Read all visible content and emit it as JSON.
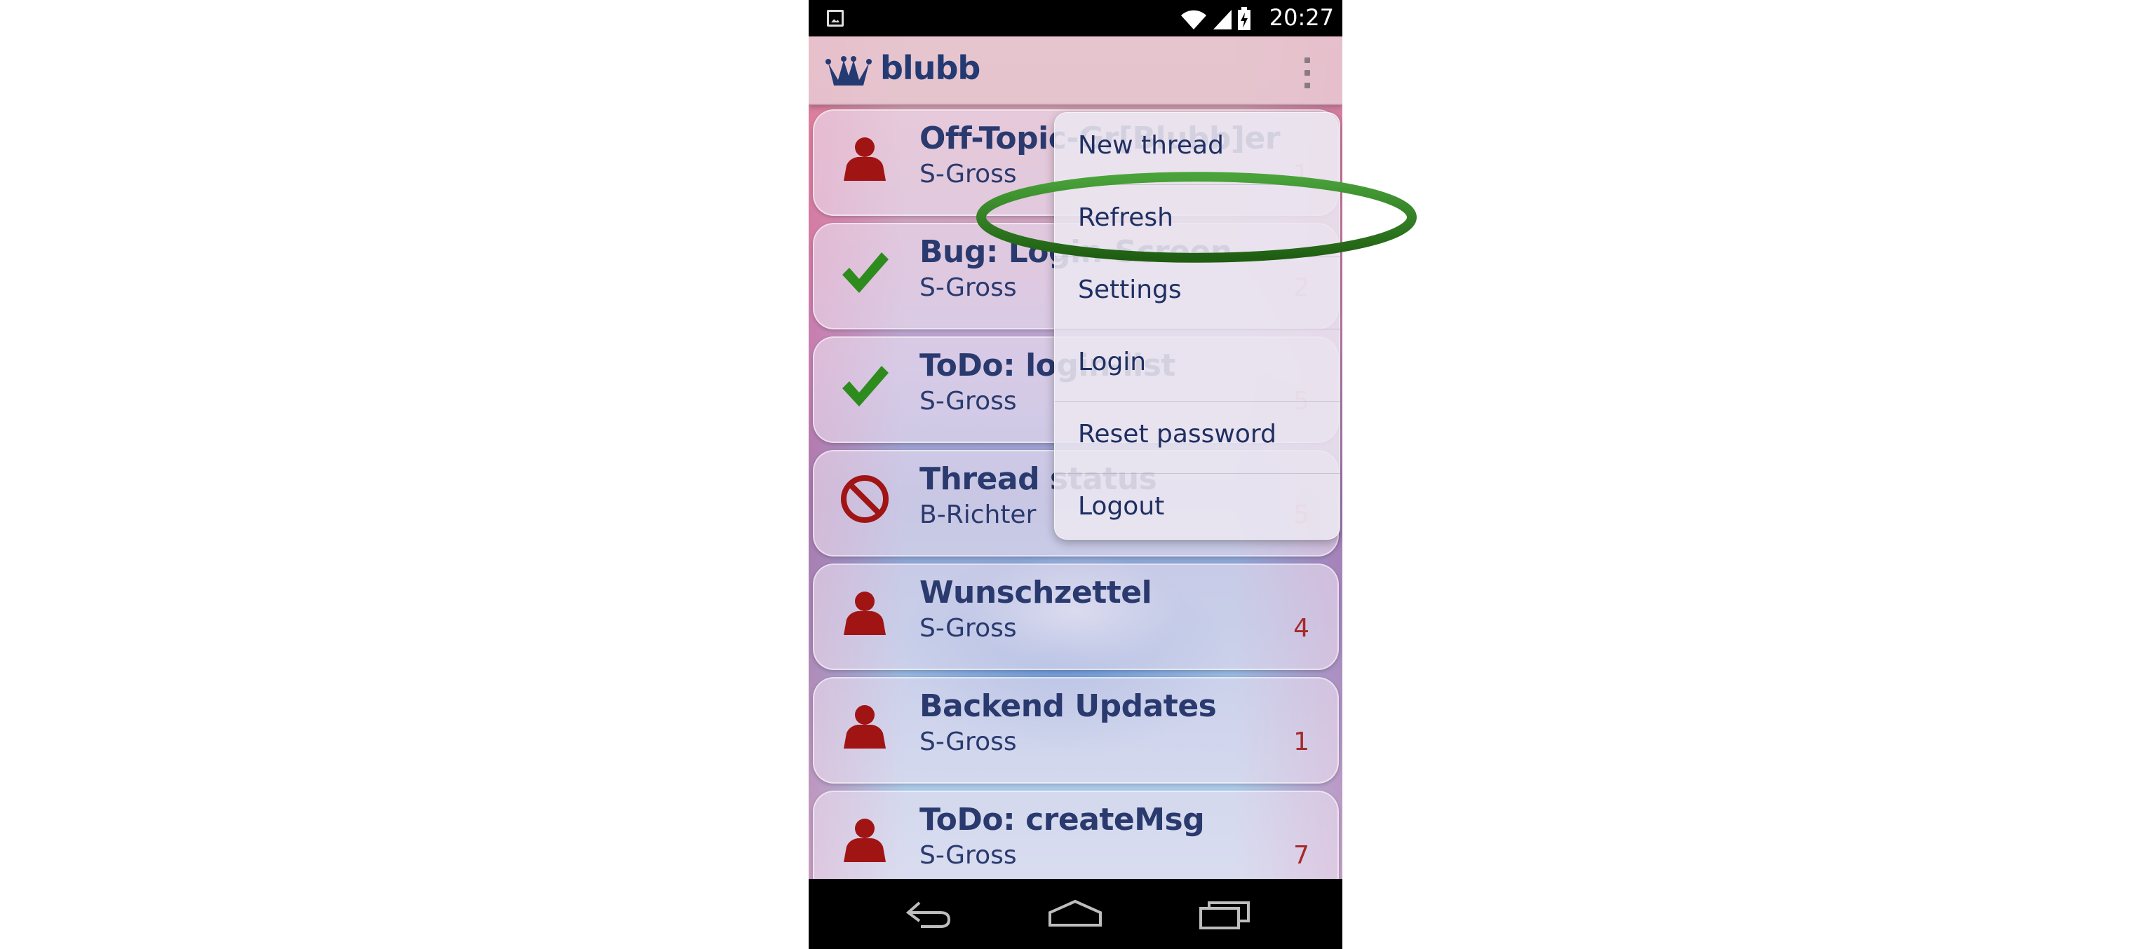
{
  "status_bar": {
    "time": "20:27",
    "icons": [
      "image-notification-icon",
      "wifi-icon",
      "signal-icon",
      "battery-charging-icon"
    ]
  },
  "app": {
    "title": "blubb",
    "logo_icon": "crown-icon",
    "overflow_icon": "more-vertical-icon"
  },
  "threads": [
    {
      "title": "Off-Topic-Gr[Blubb]er",
      "author": "S-Gross",
      "count": "1",
      "status_icon": "person-icon"
    },
    {
      "title": "Bug: Login-Screen",
      "author": "S-Gross",
      "count": "2",
      "status_icon": "checkmark-icon"
    },
    {
      "title": "ToDo: login-list",
      "author": "S-Gross",
      "count": "5",
      "status_icon": "checkmark-icon"
    },
    {
      "title": "Thread status",
      "author": "B-Richter",
      "count": "5",
      "status_icon": "prohibited-icon"
    },
    {
      "title": "Wunschzettel",
      "author": "S-Gross",
      "count": "4",
      "status_icon": "person-icon"
    },
    {
      "title": "Backend Updates",
      "author": "S-Gross",
      "count": "1",
      "status_icon": "person-icon"
    },
    {
      "title": "ToDo: createMsg",
      "author": "S-Gross",
      "count": "7",
      "status_icon": "person-icon"
    }
  ],
  "overflow_menu": {
    "items": [
      "New thread",
      "Refresh",
      "Settings",
      "Login",
      "Reset password",
      "Logout"
    ],
    "highlighted_item": "Refresh",
    "highlight_color": "#2e7d1e"
  },
  "nav_bar": {
    "icons": [
      "back-icon",
      "home-icon",
      "recent-apps-icon"
    ]
  },
  "colors": {
    "title_text": "#2a3a6e",
    "count_text": "#a52a2a",
    "person_icon": "#a01414",
    "check_icon": "#2e8b1e"
  }
}
